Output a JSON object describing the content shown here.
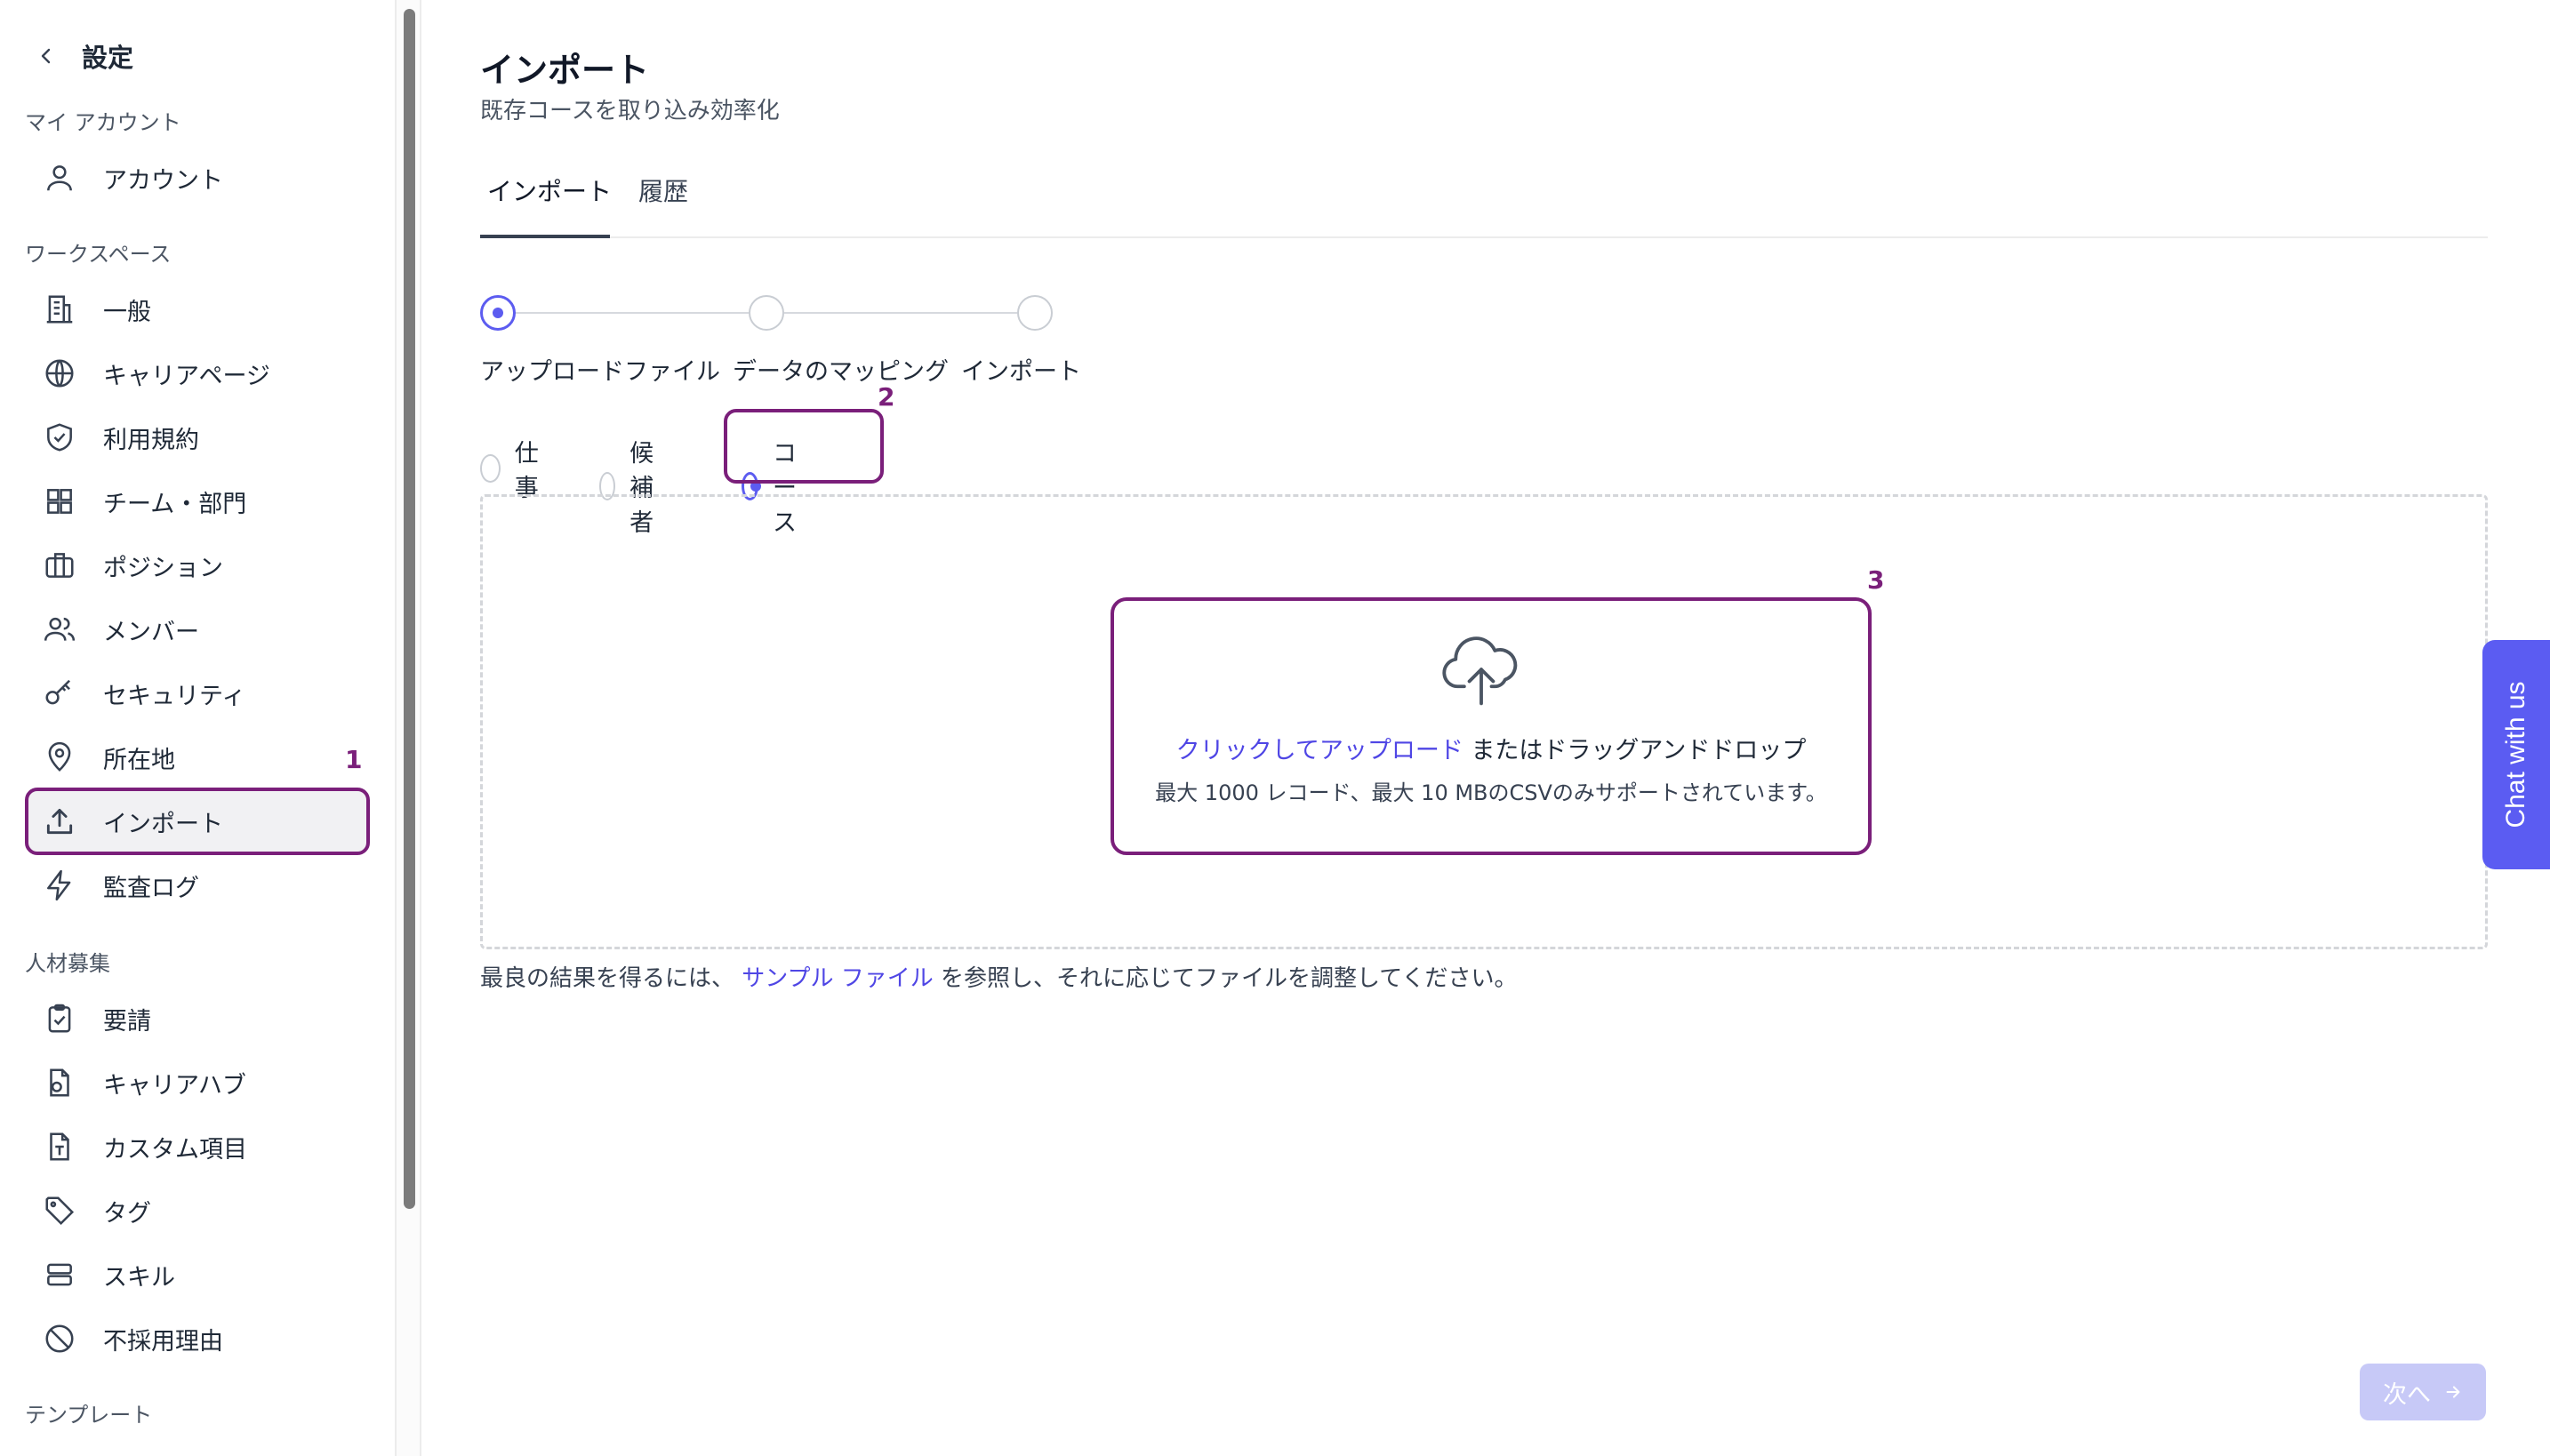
{
  "sidebar": {
    "title": "設定",
    "sections": {
      "account": "マイ アカウント",
      "workspace": "ワークスペース",
      "recruiting": "人材募集",
      "templates": "テンプレート"
    },
    "items": [
      {
        "label": "アカウント",
        "icon": "user-icon"
      },
      {
        "label": "一般",
        "icon": "building-icon"
      },
      {
        "label": "キャリアページ",
        "icon": "globe-icon"
      },
      {
        "label": "利用規約",
        "icon": "shield-check-icon"
      },
      {
        "label": "チーム・部門",
        "icon": "grid-icon"
      },
      {
        "label": "ポジション",
        "icon": "briefcase-icon"
      },
      {
        "label": "メンバー",
        "icon": "users-icon"
      },
      {
        "label": "セキュリティ",
        "icon": "key-icon"
      },
      {
        "label": "所在地",
        "icon": "map-pin-icon"
      },
      {
        "label": "インポート",
        "icon": "upload-icon",
        "active": true
      },
      {
        "label": "監査ログ",
        "icon": "lightning-icon"
      },
      {
        "label": "要請",
        "icon": "clipboard-icon"
      },
      {
        "label": "キャリアハブ",
        "icon": "file-hub-icon"
      },
      {
        "label": "カスタム項目",
        "icon": "file-text-icon"
      },
      {
        "label": "タグ",
        "icon": "tag-icon"
      },
      {
        "label": "スキル",
        "icon": "layers-icon"
      },
      {
        "label": "不採用理由",
        "icon": "ban-icon"
      }
    ]
  },
  "annotations": [
    "1",
    "2",
    "3"
  ],
  "main": {
    "title": "インポート",
    "subtitle": "既存コースを取り込み効率化",
    "tabs": [
      {
        "label": "インポート",
        "active": true
      },
      {
        "label": "履歴"
      }
    ],
    "steps": [
      "アップロードファイル",
      "データのマッピング",
      "インポート"
    ],
    "import_types": [
      {
        "label": "仕事",
        "selected": false
      },
      {
        "label": "候補者",
        "selected": false
      },
      {
        "label": "コース",
        "selected": true
      }
    ],
    "upload": {
      "link_text": "クリックしてアップロード",
      "rest_text": "またはドラッグアンドドロップ",
      "limits": "最大 1000 レコード、最大 10 MBのCSVのみサポートされています。"
    },
    "help": {
      "before": "最良の結果を得るには、",
      "link": "サンプル ファイル",
      "after": "を参照し、それに応じてファイルを調整してください。"
    },
    "next_button": "次へ"
  },
  "chat_widget": {
    "label": "Chat with us"
  },
  "colors": {
    "accent": "#5c5cf0",
    "annotation": "#7a1f7a",
    "link": "#4f46e5"
  }
}
